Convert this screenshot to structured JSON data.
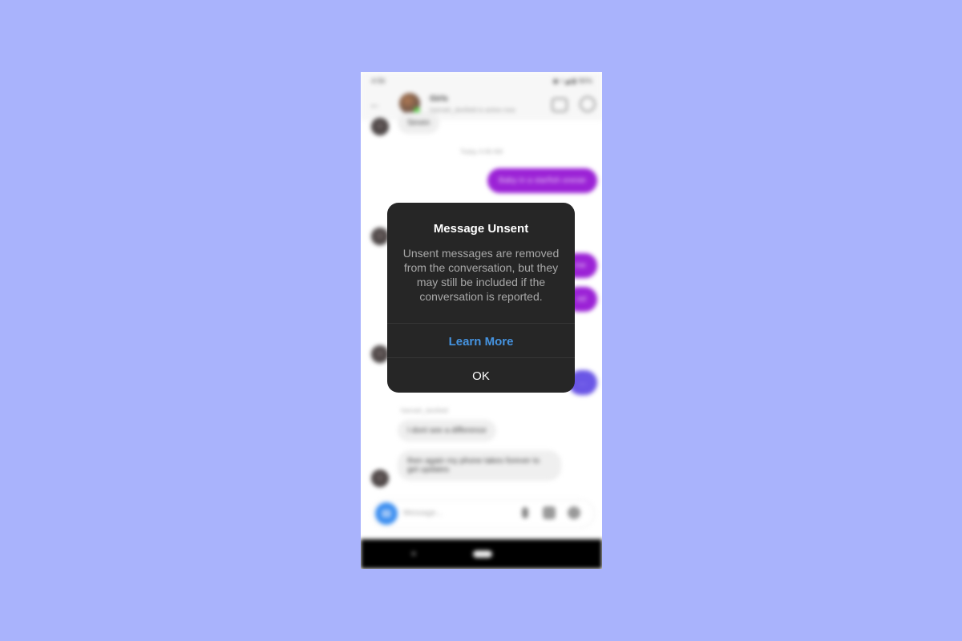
{
  "status_bar": {
    "time": "4:56",
    "icons": "◉ ▿◢ ▮ 96%"
  },
  "header": {
    "back_icon": "arrow-left-icon",
    "name": "Girls",
    "subtitle": "hannah_dexfield is active now",
    "video_icon": "video-camera-icon",
    "info_icon": "info-icon"
  },
  "messages": {
    "first_incoming": "Seven",
    "timestamp": "Today 4:46 AM",
    "outgoing_1": "Baby in a starfish onesie",
    "outgoing_2": "me",
    "outgoing_3": "ed",
    "outgoing_4": "...",
    "sender_label": "hannah_dexfield",
    "incoming_1": "I dont see a difference",
    "incoming_2": "then again my phone takes forever to get updates"
  },
  "composer": {
    "placeholder": "Message..."
  },
  "dialog": {
    "title": "Message Unsent",
    "body": "Unsent messages are removed from the conversation, but they may still be included if the conversation is reported.",
    "learn_more": "Learn More",
    "ok": "OK",
    "accent": "#4593e0"
  },
  "colors": {
    "background": "#a9b3fc",
    "outgoing_bubble": "#9b22d6",
    "dialog_bg": "#262626"
  }
}
